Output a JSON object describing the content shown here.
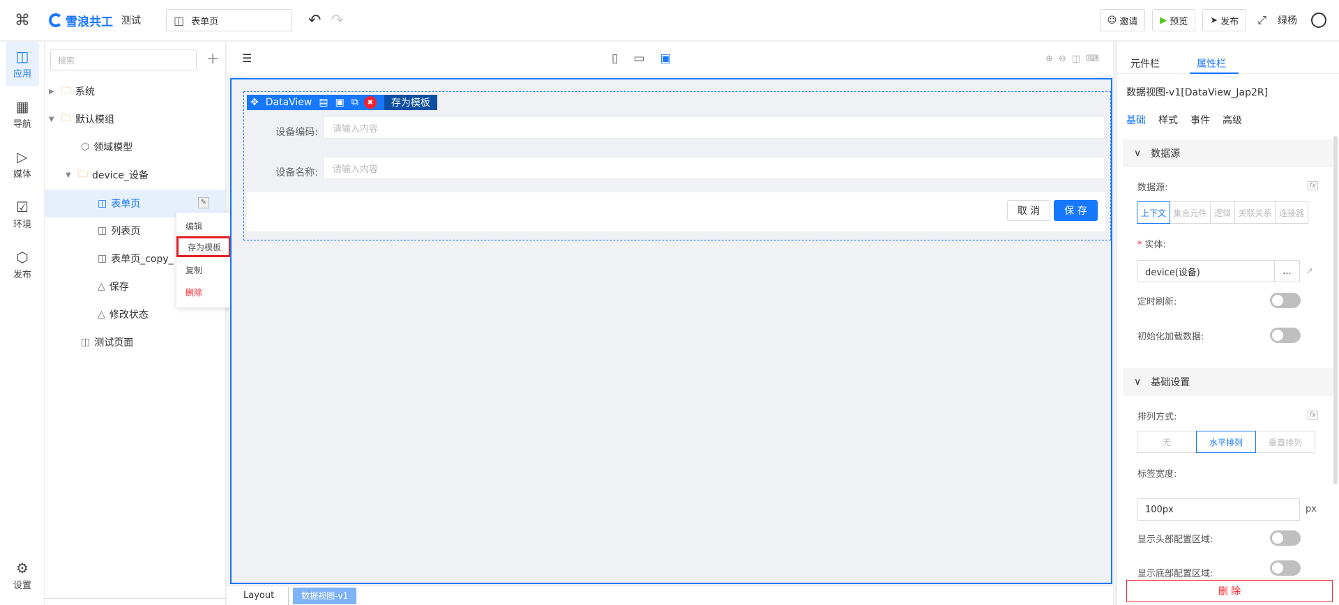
{
  "header": {
    "brand": "雪浪共工",
    "project": "测试",
    "page_select": "表单页",
    "invite": "邀请",
    "preview": "预览",
    "publish": "发布",
    "user": "绿杨"
  },
  "rail": [
    {
      "label": "应用",
      "icon": "app-icon"
    },
    {
      "label": "导航",
      "icon": "nav-icon"
    },
    {
      "label": "媒体",
      "icon": "media-icon"
    },
    {
      "label": "环境",
      "icon": "env-icon"
    },
    {
      "label": "发布",
      "icon": "publish-icon"
    },
    {
      "label": "设置",
      "icon": "gear-icon"
    }
  ],
  "tree": {
    "search_placeholder": "搜索",
    "nodes": [
      {
        "label": "系统"
      },
      {
        "label": "默认模组"
      },
      {
        "label": "领域模型"
      },
      {
        "label": "device_设备"
      },
      {
        "label": "表单页"
      },
      {
        "label": "列表页"
      },
      {
        "label": "表单页_copy_"
      },
      {
        "label": "保存"
      },
      {
        "label": "修改状态"
      },
      {
        "label": "测试页面"
      }
    ]
  },
  "context_menu": {
    "edit": "编辑",
    "save_template": "存为模板",
    "copy": "复制",
    "delete": "删除"
  },
  "canvas": {
    "toolbar_name": "DataView",
    "save_template": "存为模板",
    "field1_label": "设备编码:",
    "field1_placeholder": "请输入内容",
    "field2_label": "设备名称:",
    "field2_placeholder": "请输入内容",
    "cancel": "取 消",
    "save": "保 存"
  },
  "breadcrumb": {
    "layout": "Layout",
    "current": "数据视图-v1"
  },
  "right_panel": {
    "tab_components": "元件栏",
    "tab_properties": "属性栏",
    "component_title": "数据视图-v1[DataView_Jap2R]",
    "subtabs": [
      "基础",
      "样式",
      "事件",
      "高级"
    ],
    "section_datasource": "数据源",
    "datasource_label": "数据源:",
    "datasource_options": [
      "上下文",
      "集合元件",
      "逻辑",
      "关联关系",
      "连接器"
    ],
    "entity_label": "实体:",
    "entity_value": "device(设备)",
    "entity_more": "...",
    "timer_refresh": "定时刷新:",
    "init_load": "初始化加载数据:",
    "section_basic": "基础设置",
    "arrange_label": "排列方式:",
    "arrange_options": [
      "无",
      "水平排列",
      "垂直排列"
    ],
    "label_width_label": "标签宽度:",
    "label_width_value": "100px",
    "px": "px",
    "show_header": "显示头部配置区域:",
    "show_footer": "显示底部配置区域:",
    "delete": "删 除"
  }
}
